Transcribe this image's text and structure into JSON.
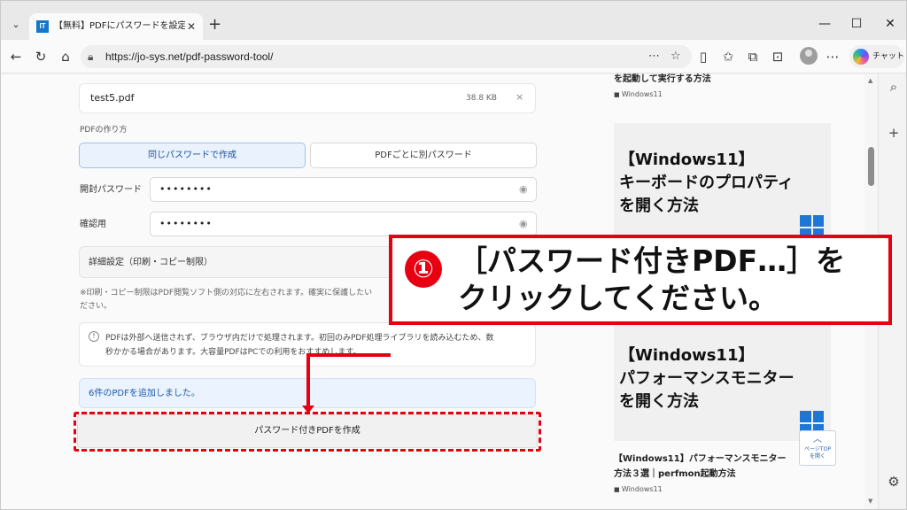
{
  "browser": {
    "tab_title": "【無料】PDFにパスワードを設定するツール",
    "tab_favicon": "IT",
    "url": "https://jo-sys.net/pdf-password-tool/",
    "chat_label": "チャット",
    "accent": "#1677c9"
  },
  "form": {
    "file": {
      "name": "test5.pdf",
      "size": "38.8 KB",
      "remove": "×"
    },
    "mode_label": "PDFの作り方",
    "mode_options": [
      "同じパスワードで作成",
      "PDFごとに別パスワード"
    ],
    "open_password_label": "開封パスワード",
    "open_password_value": "••••••••",
    "confirm_label": "確認用",
    "confirm_value": "••••••••",
    "advanced_label": "詳細設定（印刷・コピー制限）",
    "note_line1": "※印刷・コピー制限はPDF閲覧ソフト側の対応に左右されます。確実に保護したい",
    "note_line2": "ださい。",
    "info_line1": "PDFは外部へ送信されず、ブラウザ内だけで処理されます。初回のみPDF処理ライブラリを読み込むため、数",
    "info_line2": "秒かかる場合があります。大容量PDFはPCでの利用をおすすめします。",
    "success_message": "6件のPDFを追加しました。",
    "create_button": "パスワード付きPDFを作成"
  },
  "sidebar_articles": {
    "top_title": "を起動して実行する方法",
    "top_category": "Windows11",
    "card1": [
      "【Windows11】",
      "キーボードのプロパティ",
      "を開く方法"
    ],
    "card2": [
      "【Windows11】",
      "パフォーマンスモニター",
      "を開く方法"
    ],
    "bottom_title_line1": "【Windows11】パフォーマンスモニター",
    "bottom_title_line2": "方法３選｜perfmon起動方法",
    "bottom_category": "Windows11",
    "pagetop_label": "ページTOP\nを開く"
  },
  "callout": {
    "number": "①",
    "line1": "［パスワード付きPDF…］を",
    "line2": "クリックしてください。",
    "color": "#e60012"
  },
  "icons": [
    "chevron-down-icon",
    "close-icon",
    "plus-icon",
    "minimize-icon",
    "maximize-icon",
    "back-icon",
    "refresh-icon",
    "home-icon",
    "lock-icon",
    "more-icon",
    "star-icon",
    "reading-icon",
    "favorites-icon",
    "collections-icon",
    "screenshot-icon",
    "avatar-icon",
    "copilot-icon",
    "search-icon",
    "eye-icon",
    "info-icon",
    "windows-logo-icon",
    "gear-icon"
  ]
}
